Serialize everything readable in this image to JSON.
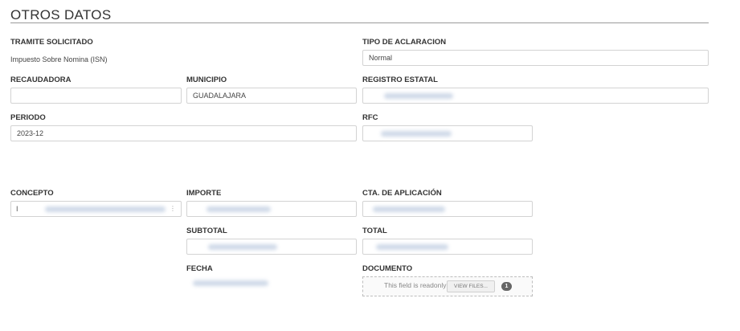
{
  "section": {
    "title": "OTROS DATOS"
  },
  "labels": {
    "tramite": "TRAMITE SOLICITADO",
    "tipo_aclaracion": "TIPO DE ACLARACION",
    "recaudadora": "RECAUDADORA",
    "municipio": "MUNICIPIO",
    "registro_estatal": "REGISTRO ESTATAL",
    "periodo": "PERIODO",
    "rfc": "RFC",
    "concepto": "CONCEPTO",
    "importe": "IMPORTE",
    "cta_aplicacion": "CTA. DE APLICACIÓN",
    "subtotal": "SUBTOTAL",
    "total": "TOTAL",
    "fecha": "FECHA",
    "documento": "DOCUMENTO"
  },
  "values": {
    "tramite": "Impuesto Sobre Nomina (ISN)",
    "tipo_aclaracion": "Normal",
    "recaudadora": "",
    "municipio": "GUADALAJARA",
    "periodo": "2023-12",
    "concepto_prefix": "I"
  },
  "documento": {
    "readonly_text": "This field is readonly",
    "view_button": "VIEW FILES...",
    "file_count": "1"
  }
}
